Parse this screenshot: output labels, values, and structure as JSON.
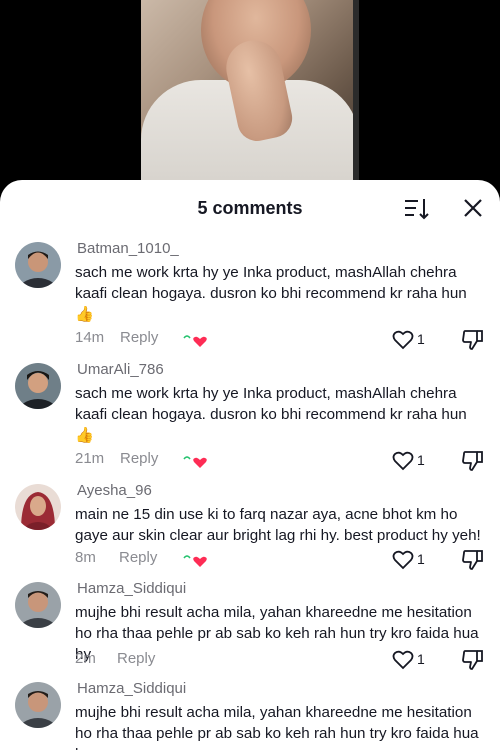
{
  "header": {
    "title": "5 comments"
  },
  "comments": [
    {
      "username": "Batman_1010_",
      "text": "sach me work krta hy ye Inka product, mashAllah chehra kaafi clean hogaya. dusron ko bhi recommend kr raha hun 👍",
      "time": "14m",
      "reply_label": "Reply",
      "likes": "1",
      "creator_liked": true
    },
    {
      "username": "UmarAli_786",
      "text": "sach me work krta hy ye Inka product, mashAllah chehra kaafi clean hogaya. dusron ko bhi recommend kr raha hun 👍",
      "time": "21m",
      "reply_label": "Reply",
      "likes": "1",
      "creator_liked": true
    },
    {
      "username": "Ayesha_96",
      "text": "main ne 15 din use ki to farq nazar aya, acne  bhot km ho gaye aur skin clear aur bright lag rhi hy. best product hy yeh!",
      "time": "8m",
      "reply_label": "Reply",
      "likes": "1",
      "creator_liked": true
    },
    {
      "username": "Hamza_Siddiqui",
      "text": "mujhe bhi result acha mila, yahan khareedne me hesitation ho rha thaa pehle pr ab sab ko keh rah hun try kro faida hua hy",
      "time": "2m",
      "reply_label": "Reply",
      "likes": "1",
      "creator_liked": false
    },
    {
      "username": "Hamza_Siddiqui",
      "text": "mujhe bhi result acha mila, yahan khareedne me hesitation ho rha thaa pehle pr ab sab ko keh rah hun try kro faida hua hy",
      "time": "",
      "reply_label": "",
      "likes": "",
      "creator_liked": false
    }
  ],
  "colors": {
    "text_primary": "#161823",
    "text_secondary": "#8a8b91",
    "heart_accent": "#fe2c55",
    "sheet_bg": "#ffffff"
  }
}
